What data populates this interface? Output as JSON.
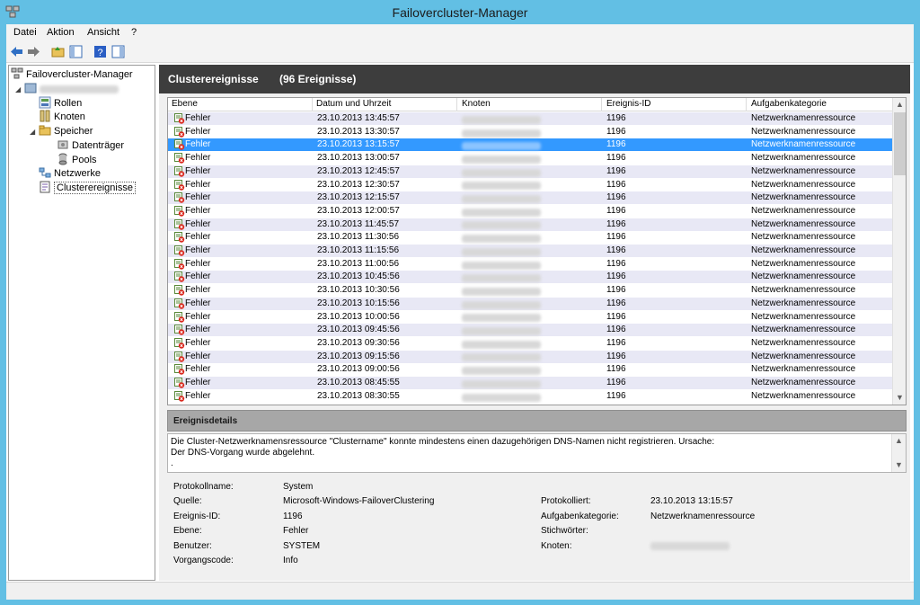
{
  "window": {
    "title": "Failovercluster-Manager"
  },
  "menu": {
    "file": "Datei",
    "action": "Aktion",
    "view": "Ansicht",
    "help": "?"
  },
  "tree": {
    "root": "Failovercluster-Manager",
    "roles": "Rollen",
    "nodes": "Knoten",
    "storage": "Speicher",
    "disks": "Datenträger",
    "pools": "Pools",
    "networks": "Netzwerke",
    "events": "Clusterereignisse"
  },
  "header": {
    "title": "Clusterereignisse",
    "count": "(96 Ereignisse)"
  },
  "grid": {
    "columns": [
      "Ebene",
      "Datum und Uhrzeit",
      "Knoten",
      "Ereignis-ID",
      "Aufgabenkategorie"
    ],
    "level": "Fehler",
    "event_id": "1196",
    "category": "Netzwerknamenressource",
    "times": [
      "23.10.2013 13:45:57",
      "23.10.2013 13:30:57",
      "23.10.2013 13:15:57",
      "23.10.2013 13:00:57",
      "23.10.2013 12:45:57",
      "23.10.2013 12:30:57",
      "23.10.2013 12:15:57",
      "23.10.2013 12:00:57",
      "23.10.2013 11:45:57",
      "23.10.2013 11:30:56",
      "23.10.2013 11:15:56",
      "23.10.2013 11:00:56",
      "23.10.2013 10:45:56",
      "23.10.2013 10:30:56",
      "23.10.2013 10:15:56",
      "23.10.2013 10:00:56",
      "23.10.2013 09:45:56",
      "23.10.2013 09:30:56",
      "23.10.2013 09:15:56",
      "23.10.2013 09:00:56",
      "23.10.2013 08:45:55",
      "23.10.2013 08:30:55"
    ]
  },
  "details": {
    "title": "Ereignisdetails",
    "message_line1": "Die Cluster-Netzwerknamensressource \"Clustername\" konnte mindestens einen dazugehörigen DNS-Namen nicht registrieren. Ursache:",
    "message_line2": "Der DNS-Vorgang wurde abgelehnt.",
    "message_line3": ".",
    "labels": {
      "log_name": "Protokollname:",
      "source": "Quelle:",
      "event_id": "Ereignis-ID:",
      "level": "Ebene:",
      "user": "Benutzer:",
      "opcode": "Vorgangscode:",
      "logged": "Protokolliert:",
      "task_category": "Aufgabenkategorie:",
      "keywords": "Stichwörter:",
      "computer": "Knoten:"
    },
    "values": {
      "log_name": "System",
      "source": "Microsoft-Windows-FailoverClustering",
      "event_id": "1196",
      "level": "Fehler",
      "user": "SYSTEM",
      "opcode": "Info",
      "logged": "23.10.2013 13:15:57",
      "task_category": "Netzwerknamenressource"
    }
  },
  "icons": [
    "cluster-manager-icon",
    "back-arrow-icon",
    "forward-arrow-icon",
    "folder-up-icon",
    "console-tree-icon",
    "help-icon",
    "action-pane-icon",
    "roles-icon",
    "nodes-icon",
    "storage-icon",
    "disk-icon",
    "pool-icon",
    "network-icon",
    "events-icon",
    "error-event-icon"
  ]
}
